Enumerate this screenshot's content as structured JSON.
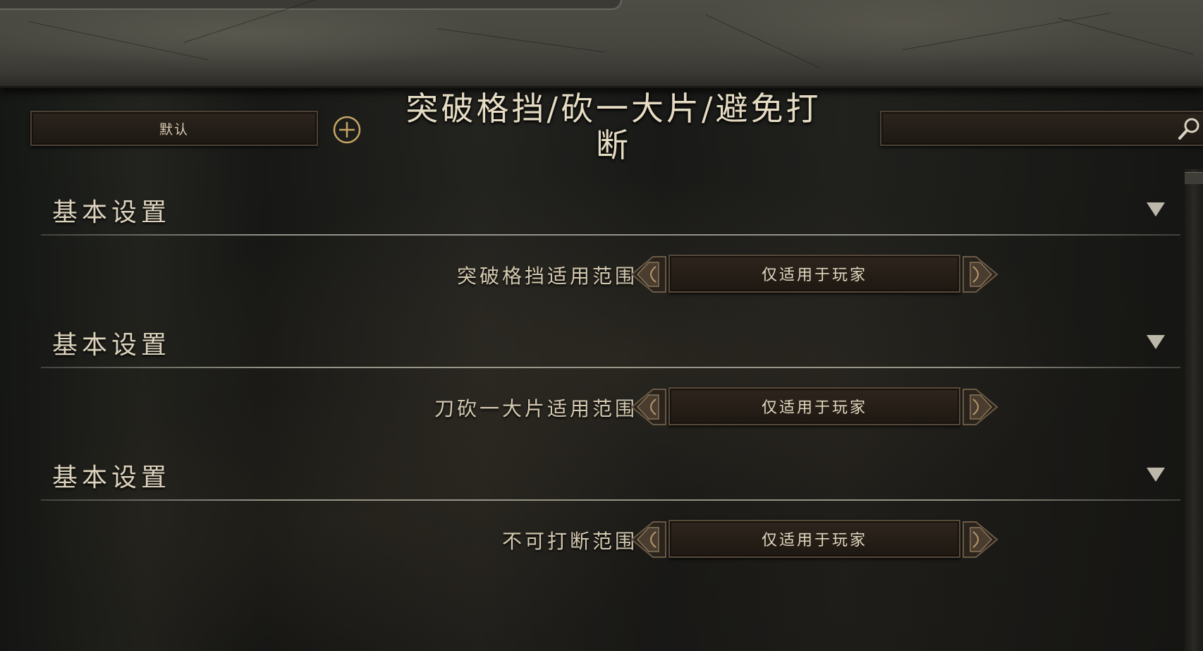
{
  "header": {
    "preset_value": "默认",
    "title": "突破格挡/砍一大片/避免打断",
    "search_placeholder": ""
  },
  "sections": [
    {
      "title": "基本设置",
      "setting": {
        "label": "突破格挡适用范围",
        "value": "仅适用于玩家"
      }
    },
    {
      "title": "基本设置",
      "setting": {
        "label": "刀砍一大片适用范围",
        "value": "仅适用于玩家"
      }
    },
    {
      "title": "基本设置",
      "setting": {
        "label": "不可打断范围",
        "value": "仅适用于玩家"
      }
    }
  ],
  "colors": {
    "accent_gold": "#c8a565",
    "text_light": "#e2d7bf"
  }
}
